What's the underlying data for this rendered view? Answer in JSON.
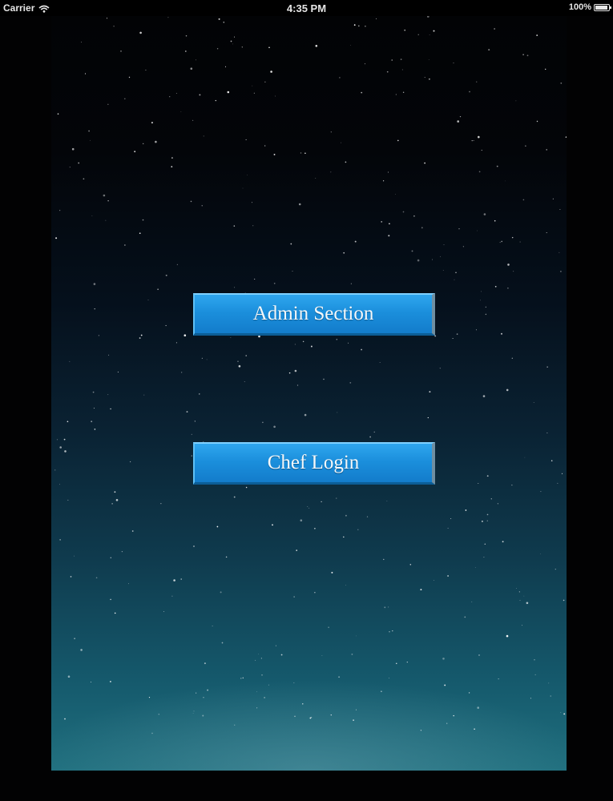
{
  "status_bar": {
    "carrier": "Carrier",
    "time": "4:35 PM",
    "battery_text": "100%",
    "battery_level": 1.0,
    "icons": [
      "wifi-icon",
      "battery-icon"
    ]
  },
  "background": {
    "description_colors": [
      "#020305",
      "#0a2233",
      "#1f6f7e"
    ]
  },
  "buttons": {
    "admin_label": "Admin Section",
    "chef_label": "Chef Login",
    "color": "#1b8fdc"
  }
}
